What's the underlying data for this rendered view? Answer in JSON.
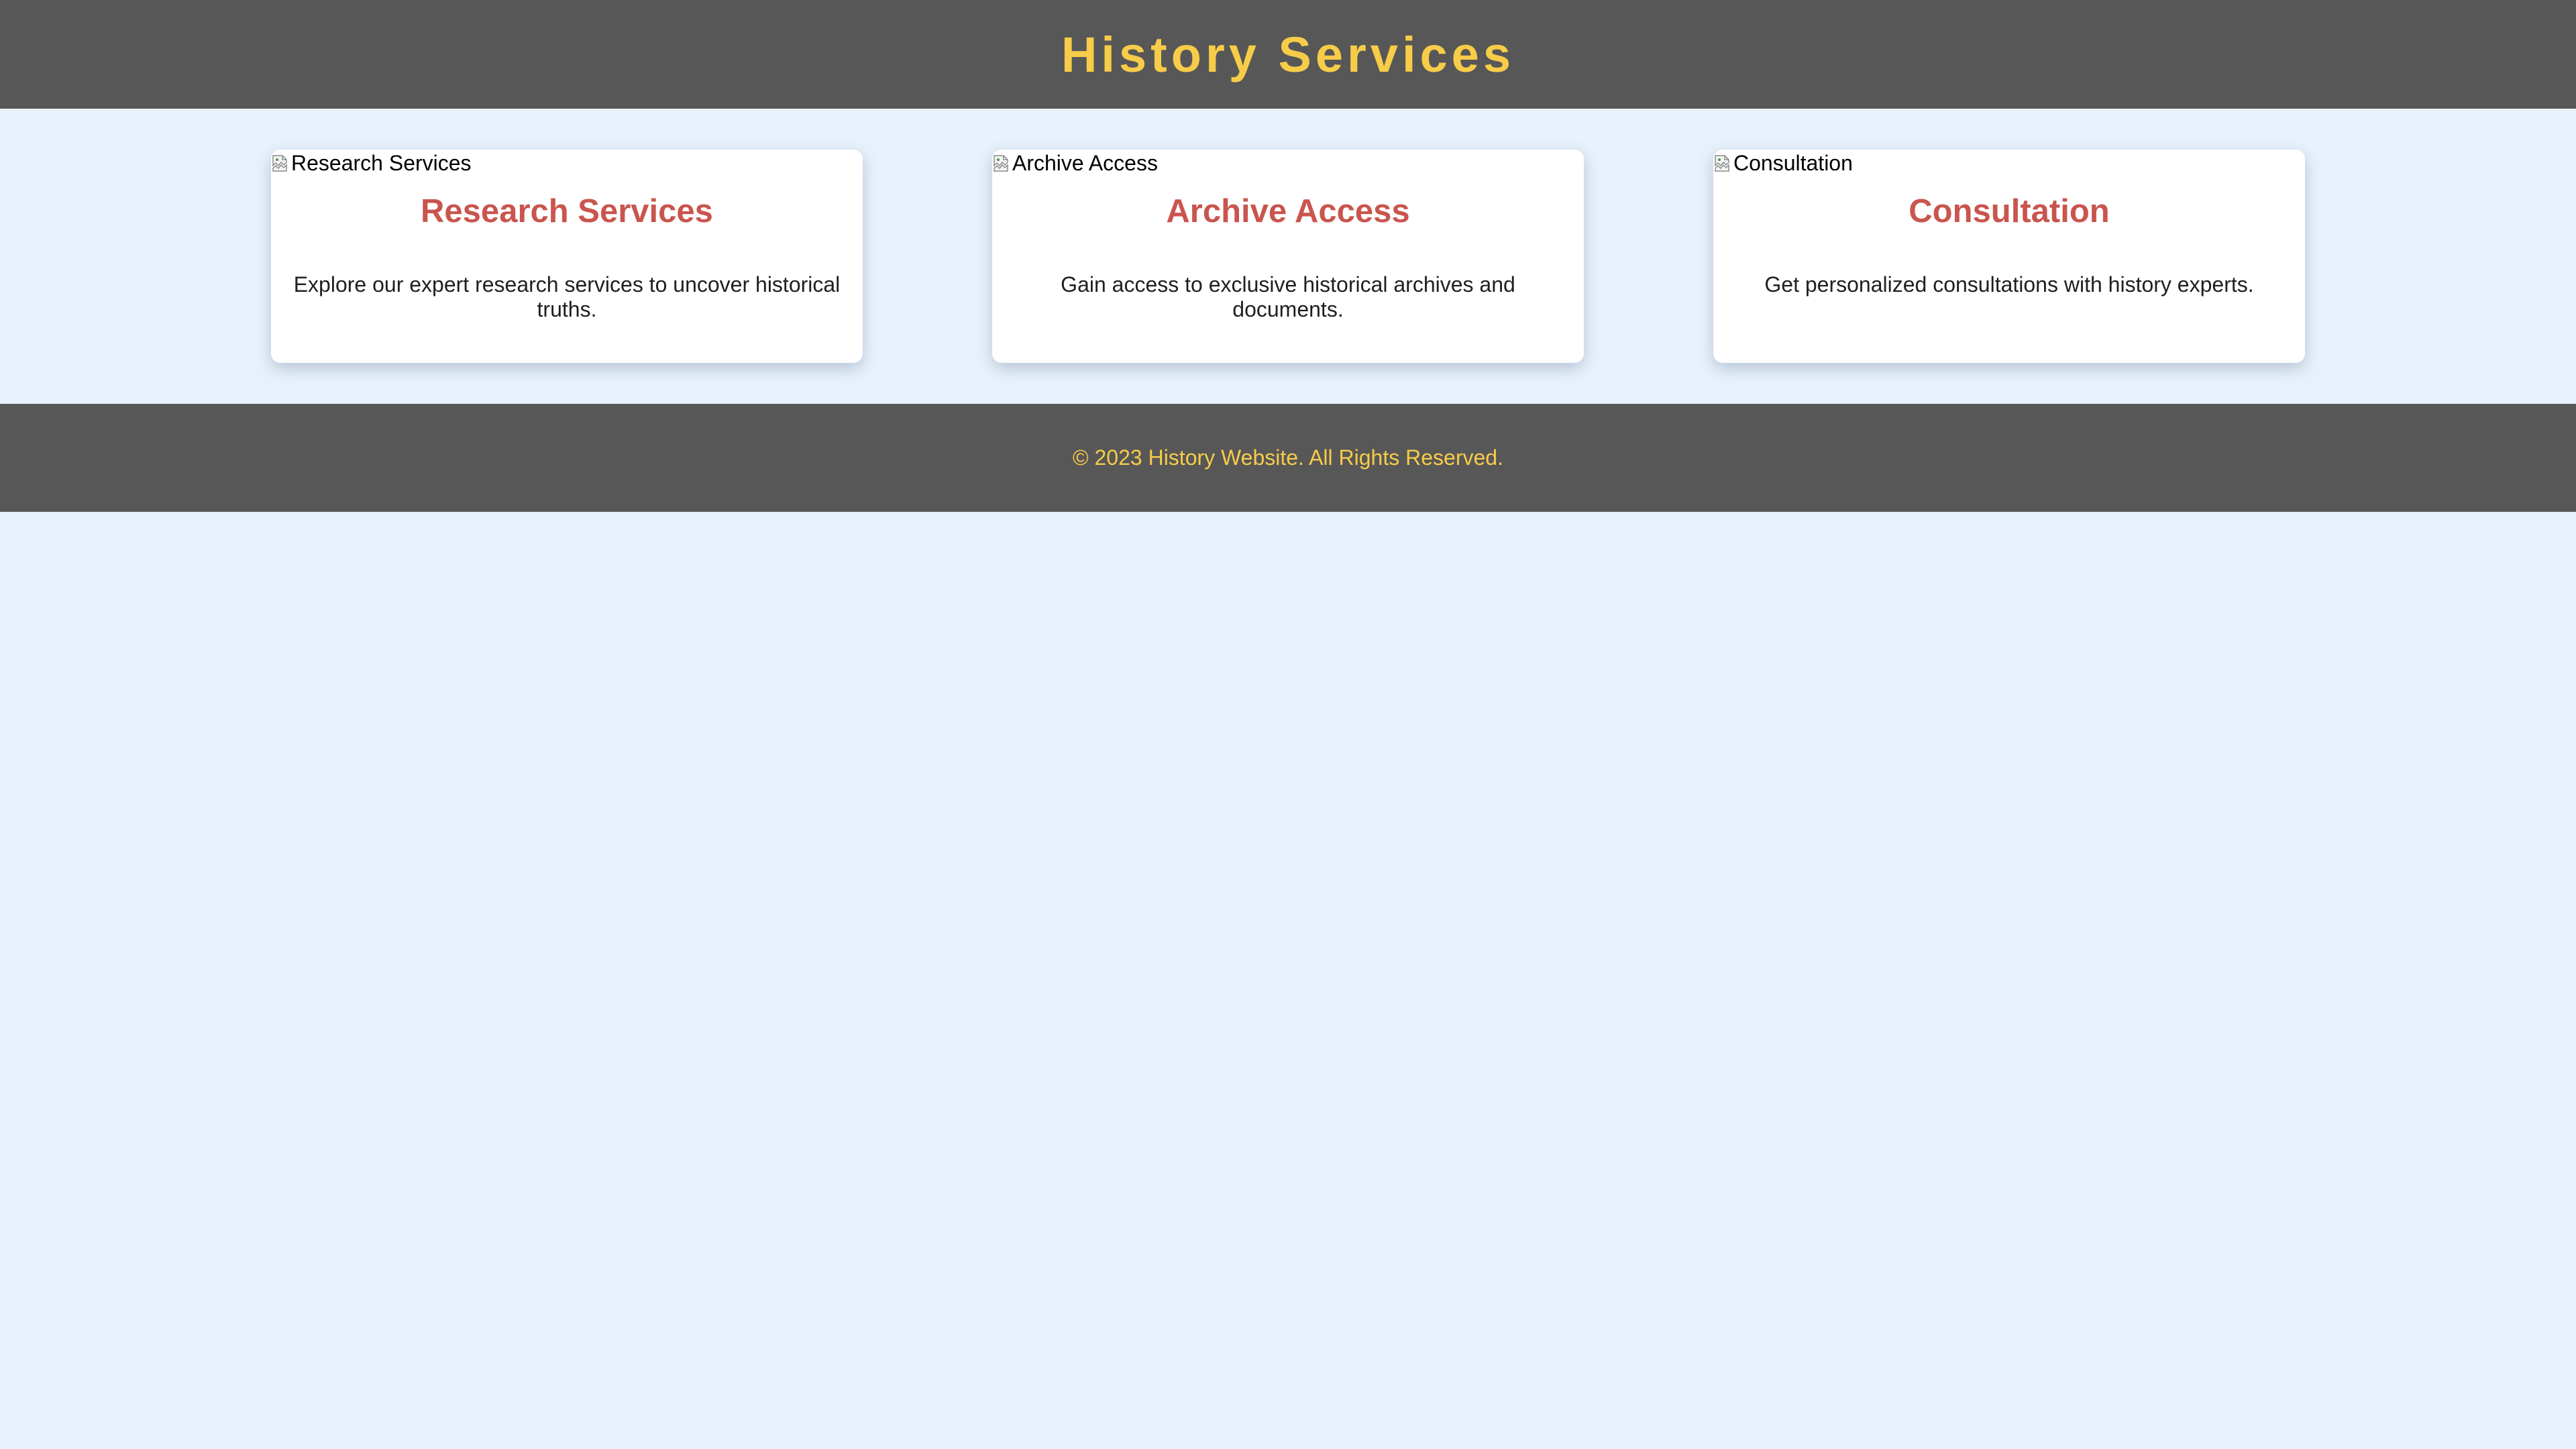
{
  "header": {
    "title": "History Services"
  },
  "services": [
    {
      "image_alt": "Research Services",
      "title": "Research Services",
      "description": "Explore our expert research services to uncover historical truths."
    },
    {
      "image_alt": "Archive Access",
      "title": "Archive Access",
      "description": "Gain access to exclusive historical archives and documents."
    },
    {
      "image_alt": "Consultation",
      "title": "Consultation",
      "description": "Get personalized consultations with history experts."
    }
  ],
  "footer": {
    "text": "© 2023 History Website. All Rights Reserved."
  },
  "icons": {
    "card_image": "broken-image-icon"
  },
  "colors": {
    "header_bg": "#575757",
    "accent_yellow": "#f7cc48",
    "card_title": "#c9554e",
    "page_bg": "#e8f2fc",
    "card_bg": "#ffffff"
  }
}
